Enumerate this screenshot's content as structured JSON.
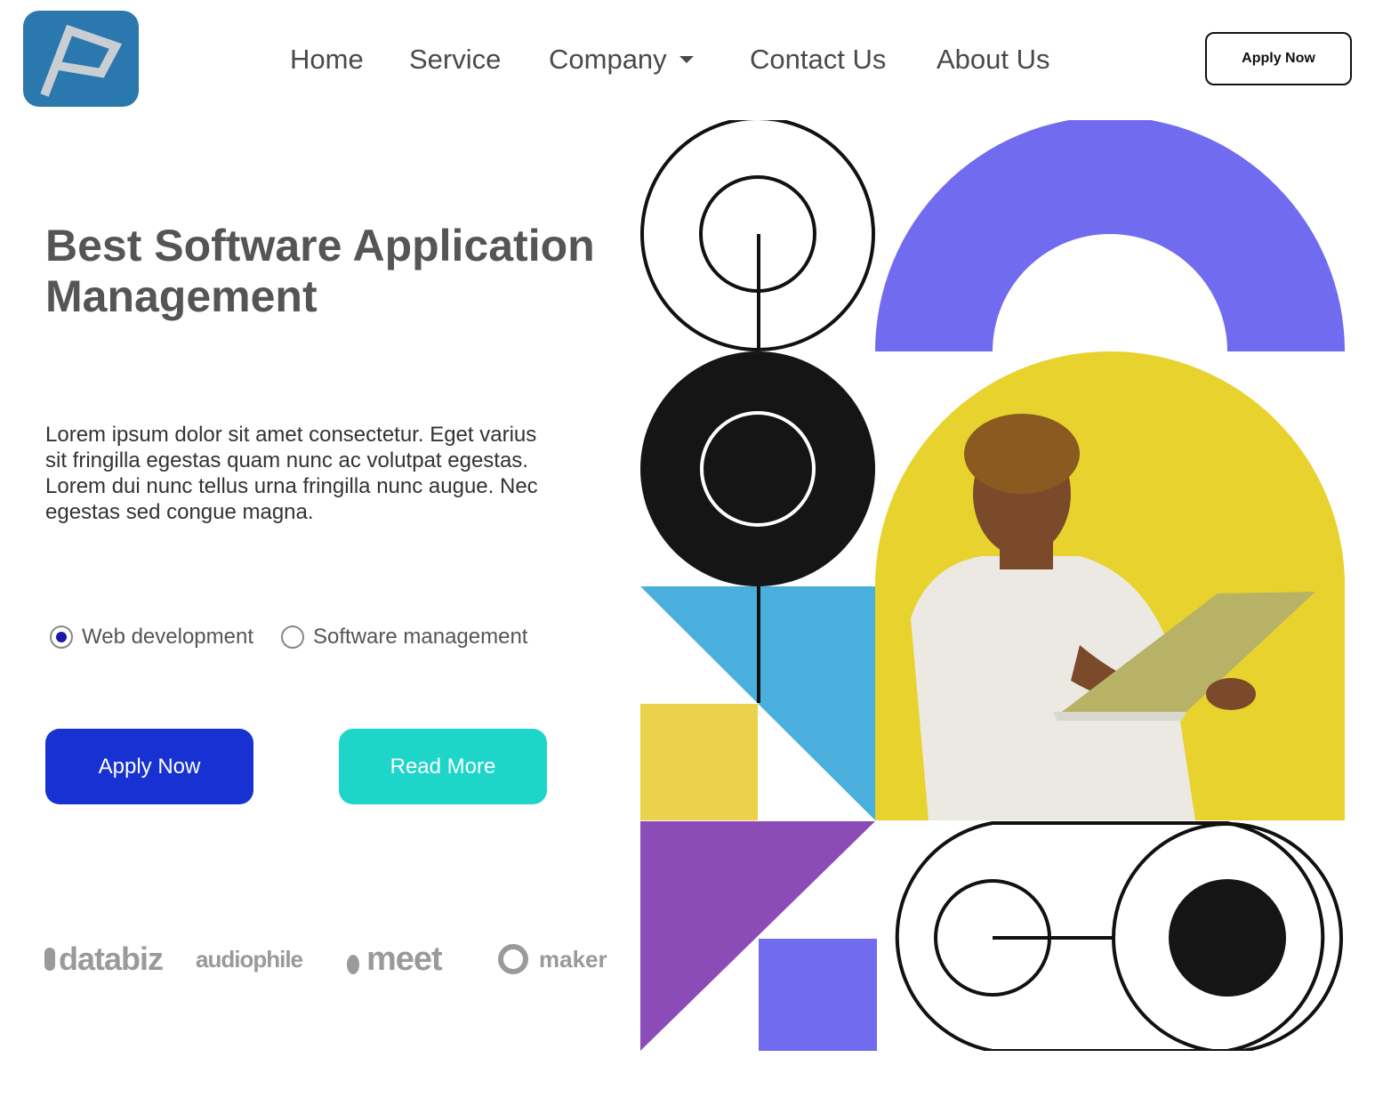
{
  "header": {
    "nav": [
      {
        "label": "Home"
      },
      {
        "label": "Service"
      },
      {
        "label": "Company"
      },
      {
        "label": "Contact Us"
      },
      {
        "label": "About Us"
      }
    ],
    "apply_label": "Apply Now"
  },
  "hero": {
    "title": "Best Software Application Management",
    "description": "Lorem ipsum dolor sit amet consectetur. Eget varius sit fringilla egestas quam nunc ac volutpat egestas. Lorem dui nunc tellus urna fringilla nunc augue. Nec egestas sed congue magna.",
    "options": [
      {
        "label": "Web development",
        "checked": true
      },
      {
        "label": "Software management",
        "checked": false
      }
    ],
    "apply_label": "Apply Now",
    "read_more_label": "Read More"
  },
  "partners": [
    "databiz",
    "audiophile",
    "meet",
    "maker"
  ],
  "colors": {
    "primary_button": "#1831d3",
    "secondary_button": "#1dd6c9",
    "logo_bg": "#2b78ae",
    "arch_purple": "#716cef",
    "photo_yellow": "#e8d22e",
    "blue_triangle": "#4aafdc",
    "yellow_square": "#ecd24a",
    "purple_triangle": "#8b4cb7"
  }
}
